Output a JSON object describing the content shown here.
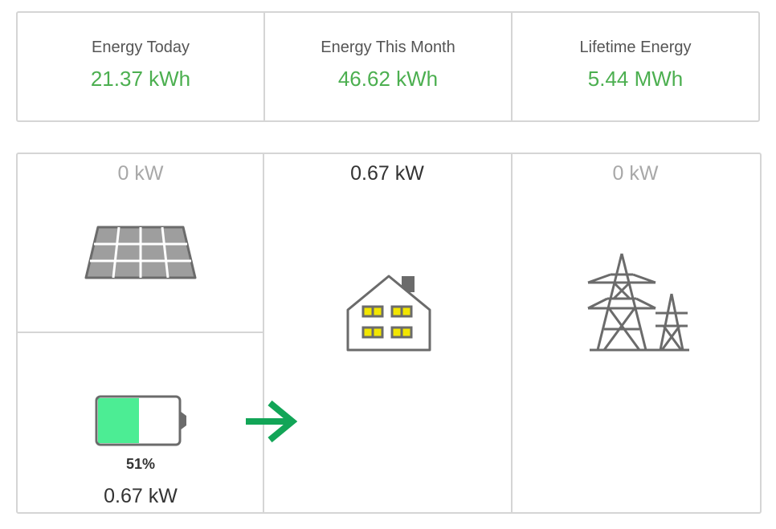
{
  "stats": {
    "today": {
      "label": "Energy Today",
      "value": "21.37 kWh"
    },
    "month": {
      "label": "Energy This Month",
      "value": "46.62 kWh"
    },
    "lifetime": {
      "label": "Lifetime Energy",
      "value": "5.44 MWh"
    }
  },
  "flow": {
    "solar": {
      "power": "0 kW",
      "icon": "solar-panel-icon"
    },
    "home": {
      "power": "0.67 kW",
      "icon": "house-icon"
    },
    "grid": {
      "power": "0 kW",
      "icon": "power-tower-icon"
    },
    "battery": {
      "power": "0.67 kW",
      "level_label": "51%",
      "level": 51,
      "icon": "battery-icon"
    },
    "arrow_icon": "arrow-right-icon"
  },
  "colors": {
    "value_green": "#4caf50",
    "battery_fill": "#4ced94",
    "arrow_green": "#12a557",
    "icon_gray": "#6b6b6b",
    "window_yellow": "#f2e600",
    "border": "#d5d5d5"
  }
}
